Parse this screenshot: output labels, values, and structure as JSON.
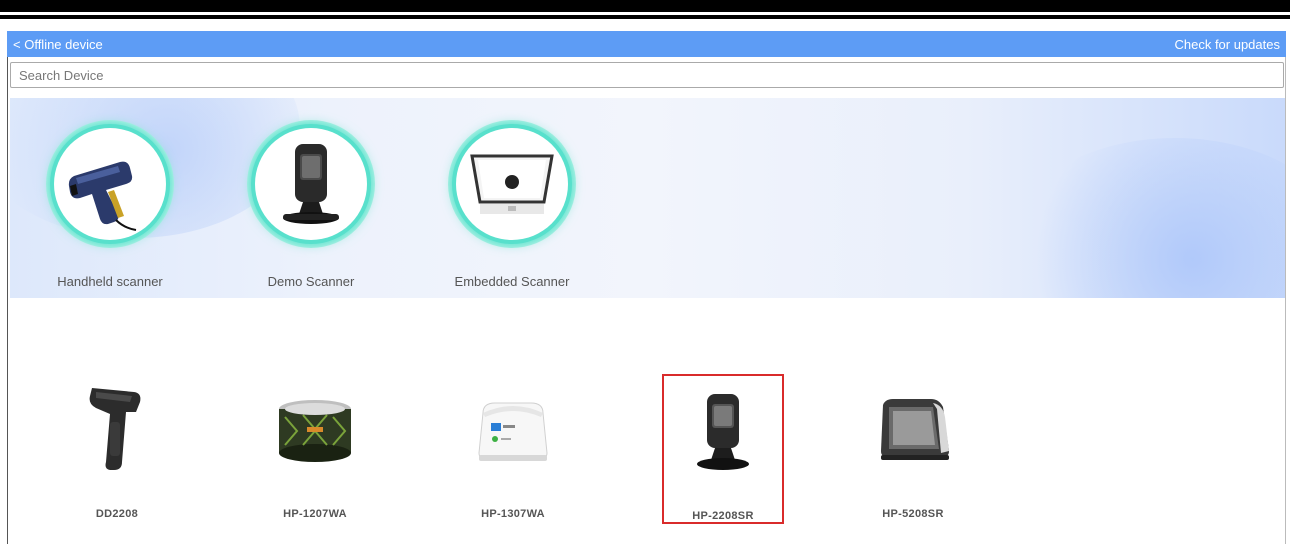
{
  "header": {
    "back_label": "< Offline device",
    "update_label": "Check for updates",
    "bg_color": "#5d9cf5"
  },
  "search": {
    "placeholder": "Search Device"
  },
  "categories": [
    {
      "label": "Handheld scanner",
      "icon": "handheld-scanner-image"
    },
    {
      "label": "Demo Scanner",
      "icon": "presentation-scanner-image"
    },
    {
      "label": "Embedded Scanner",
      "icon": "embedded-scanner-image"
    }
  ],
  "products": [
    {
      "name": "DD2208",
      "icon": "handheld-scanner-image",
      "selected": false
    },
    {
      "name": "HP-1207WA",
      "icon": "round-scanner-image",
      "selected": false
    },
    {
      "name": "HP-1307WA",
      "icon": "white-desktop-scanner-image",
      "selected": false
    },
    {
      "name": "HP-2208SR",
      "icon": "presentation-scanner-image",
      "selected": true
    },
    {
      "name": "HP-5208SR",
      "icon": "box-scanner-image",
      "selected": false
    }
  ],
  "colors": {
    "accent": "#5d9cf5",
    "selected_border": "#d92b2b",
    "ring_glow": "#58e0cc"
  }
}
